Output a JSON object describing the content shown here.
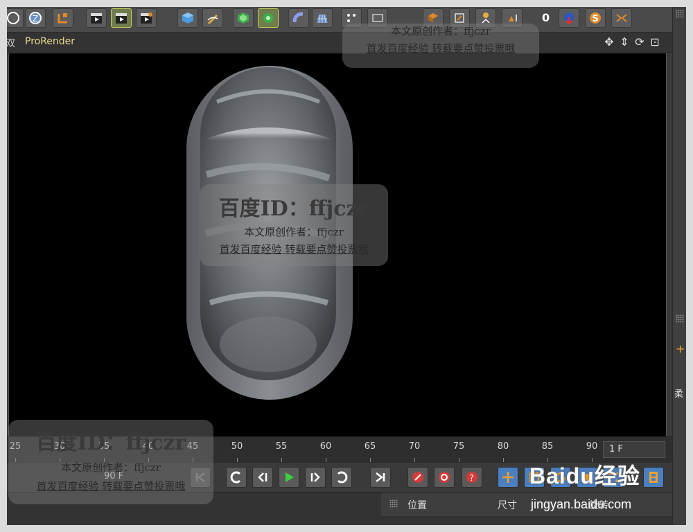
{
  "toolbar": {
    "counter": "0"
  },
  "viewport": {
    "partial_tab": "双",
    "renderer": "ProRender"
  },
  "timeline": {
    "ticks": [
      "25",
      "30",
      "35",
      "40",
      "45",
      "50",
      "55",
      "60",
      "65",
      "70",
      "75",
      "80",
      "85",
      "90"
    ],
    "current_frame": "1 F"
  },
  "transport": {
    "end_frame": "90 F"
  },
  "coordinates": {
    "position_label": "位置",
    "size_label": "尺寸",
    "rotation_label": "旋转"
  },
  "watermarks": {
    "id_text": "百度ID：ffjczr",
    "author_line": "本文原创作者：ffjczr",
    "promo_line": "首发百度经验  转载要点赞投票哦"
  },
  "baidu": {
    "logo_text": "Baidu经验",
    "url": "jingyan.baidu.com"
  },
  "right_panel": {
    "tab_label": "柔"
  },
  "colors": {
    "viewport_bg": "#000000",
    "accent_prorender": "#e8d88a",
    "play_green": "#3ecf3e",
    "record_red": "#d33a3a",
    "transform_blue": "#4a7fc0"
  }
}
